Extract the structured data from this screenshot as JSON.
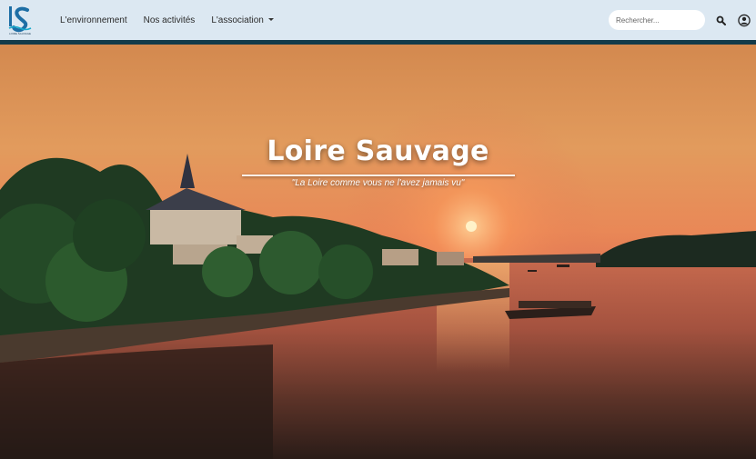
{
  "header": {
    "logo_text": "LOIRE SAUVAGE",
    "nav": [
      {
        "label": "L'environnement"
      },
      {
        "label": "Nos activités"
      },
      {
        "label": "L'association"
      }
    ],
    "search": {
      "placeholder": "Rechercher..."
    }
  },
  "hero": {
    "title": "Loire Sauvage",
    "subtitle": "\"La Loire comme vous ne l'avez jamais vu\""
  },
  "colors": {
    "navbar_bg": "#dce8f2",
    "navbar_border": "#123b4a",
    "logo_blue": "#1d6ea5"
  },
  "icons": [
    "logo-icon",
    "search-icon",
    "user-icon",
    "caret-down-icon"
  ]
}
